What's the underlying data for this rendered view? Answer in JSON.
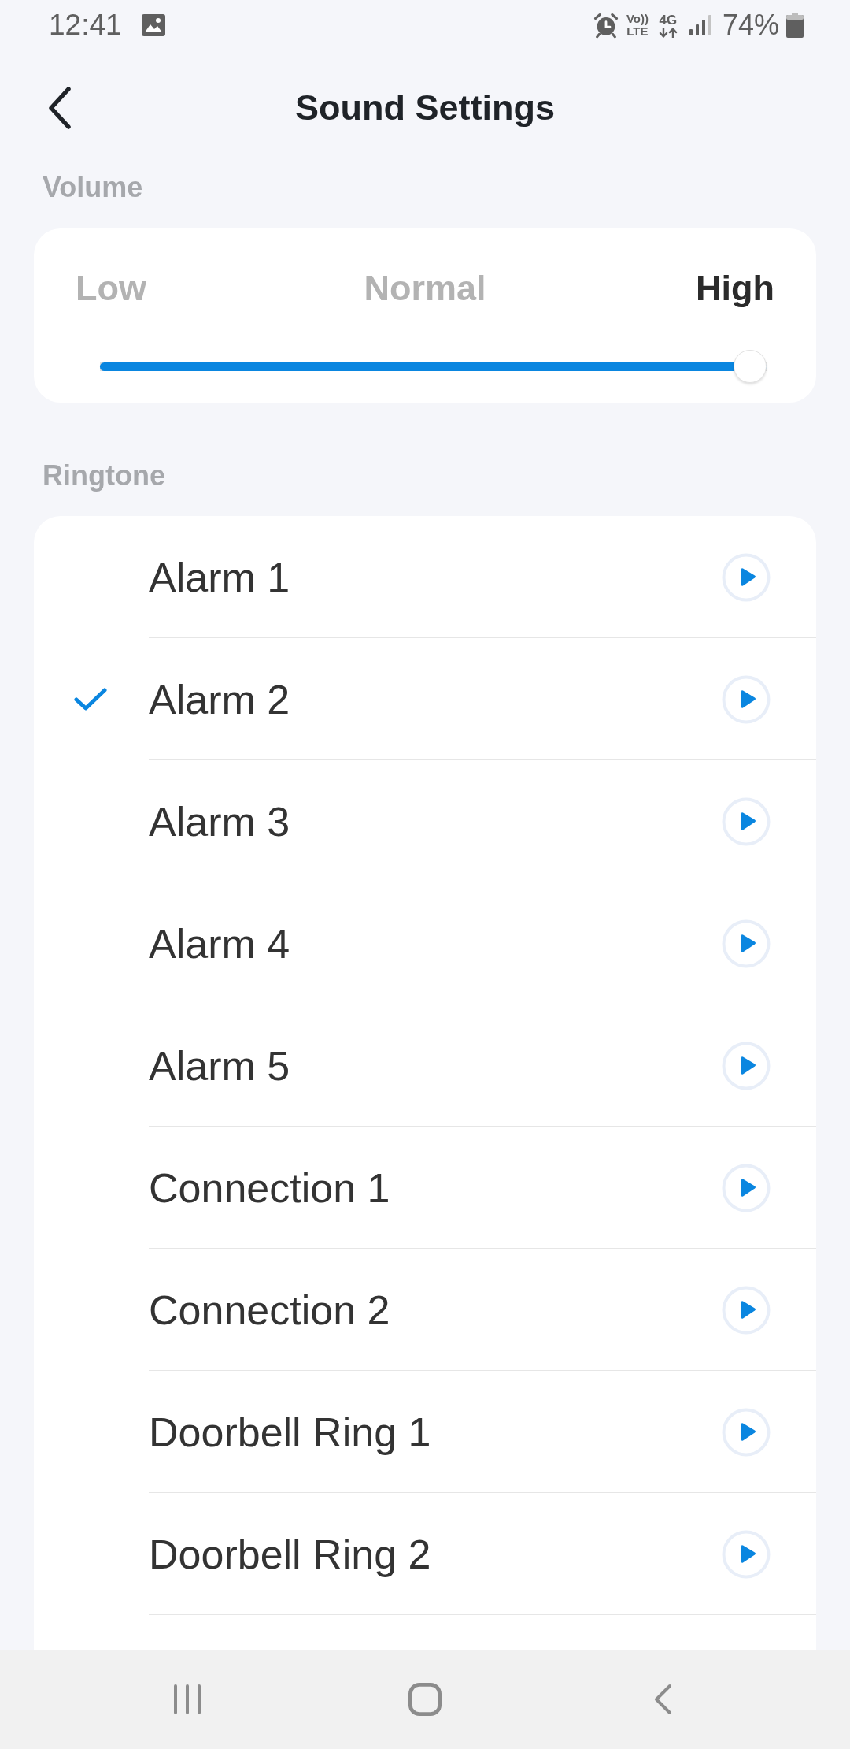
{
  "status_bar": {
    "time": "12:41",
    "volte": {
      "top": "Vo))",
      "bottom": "LTE"
    },
    "network": "4G",
    "battery": "74%"
  },
  "header": {
    "title": "Sound Settings"
  },
  "volume": {
    "label": "Volume",
    "levels": [
      {
        "label": "Low",
        "selected": false
      },
      {
        "label": "Normal",
        "selected": false
      },
      {
        "label": "High",
        "selected": true
      }
    ],
    "level": 1
  },
  "ringtone": {
    "label": "Ringtone",
    "items": [
      {
        "name": "Alarm 1",
        "selected": false
      },
      {
        "name": "Alarm 2",
        "selected": true
      },
      {
        "name": "Alarm 3",
        "selected": false
      },
      {
        "name": "Alarm 4",
        "selected": false
      },
      {
        "name": "Alarm 5",
        "selected": false
      },
      {
        "name": "Connection 1",
        "selected": false
      },
      {
        "name": "Connection 2",
        "selected": false
      },
      {
        "name": "Doorbell Ring 1",
        "selected": false
      },
      {
        "name": "Doorbell Ring 2",
        "selected": false
      }
    ]
  }
}
